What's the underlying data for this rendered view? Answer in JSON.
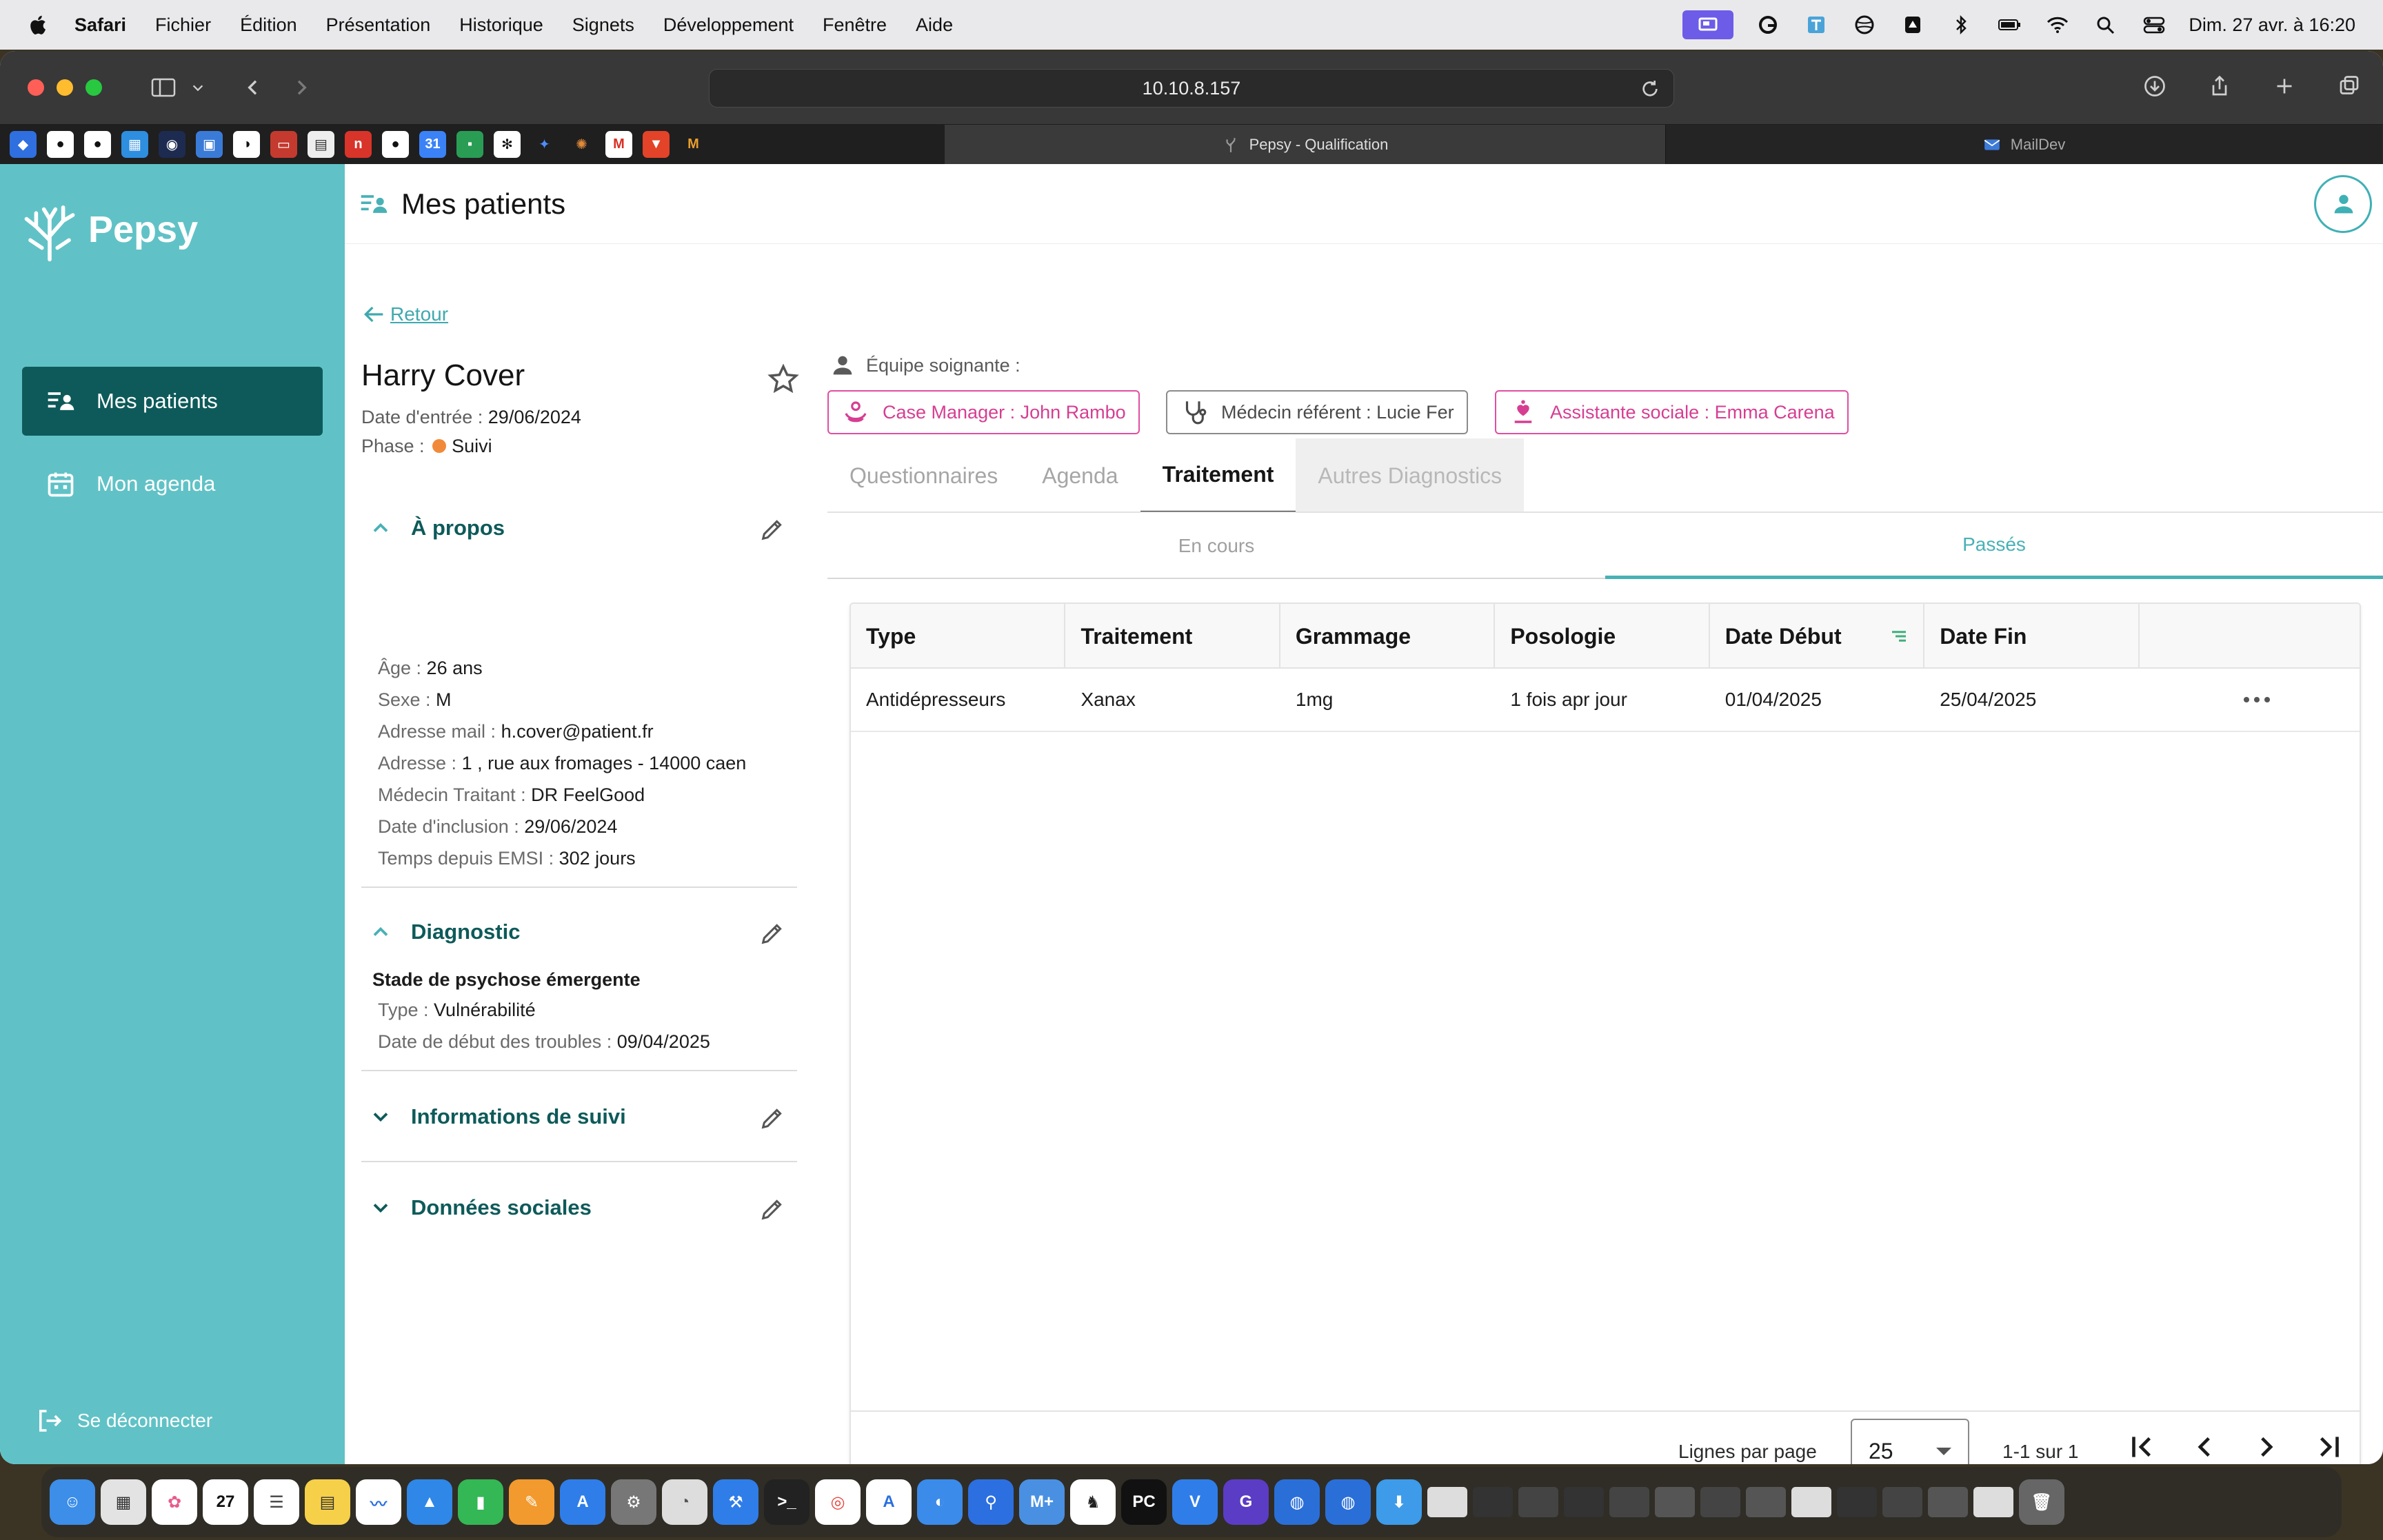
{
  "menubar": {
    "app": "Safari",
    "items": [
      "Fichier",
      "Édition",
      "Présentation",
      "Historique",
      "Signets",
      "Développement",
      "Fenêtre",
      "Aide"
    ],
    "clock": "Dim. 27 avr. à 16:20"
  },
  "browser": {
    "url": "10.10.8.157",
    "tabs": [
      {
        "label": "Pepsy - Qualification",
        "active": true
      },
      {
        "label": "MailDev",
        "active": false
      }
    ]
  },
  "sidebar": {
    "brand": "Pepsy",
    "nav": [
      {
        "label": "Mes patients",
        "active": true
      },
      {
        "label": "Mon agenda",
        "active": false
      }
    ],
    "logout": "Se déconnecter"
  },
  "header": {
    "title": "Mes patients"
  },
  "patient": {
    "back_label": "Retour",
    "name": "Harry Cover",
    "entry_label": "Date d'entrée : ",
    "entry_date": "29/06/2024",
    "phase_label": "Phase : ",
    "phase": "Suivi",
    "phase_color": "#f08a3a"
  },
  "about": {
    "title": "À propos",
    "fields": [
      {
        "label": "Âge : ",
        "value": "26 ans"
      },
      {
        "label": "Sexe : ",
        "value": "M"
      },
      {
        "label": "Adresse mail : ",
        "value": "h.cover@patient.fr"
      },
      {
        "label": "Adresse : ",
        "value": "1 , rue aux fromages - 14000 caen"
      },
      {
        "label": "Médecin Traitant : ",
        "value": "DR FeelGood"
      },
      {
        "label": "Date d'inclusion : ",
        "value": "29/06/2024"
      },
      {
        "label": "Temps depuis EMSI : ",
        "value": "302 jours"
      }
    ]
  },
  "diagnostic": {
    "title": "Diagnostic",
    "stage": "Stade de psychose émergente",
    "fields": [
      {
        "label": "Type : ",
        "value": "Vulnérabilité"
      },
      {
        "label": "Date de début des troubles : ",
        "value": "09/04/2025"
      }
    ]
  },
  "followup": {
    "title": "Informations de suivi"
  },
  "social": {
    "title": "Données sociales"
  },
  "team": {
    "label": "Équipe soignante :",
    "members": [
      {
        "label": "Case Manager : John Rambo",
        "style": "pink"
      },
      {
        "label": "Médecin référent : Lucie Fer",
        "style": "grey"
      },
      {
        "label": "Assistante sociale : Emma Carena",
        "style": "pink"
      }
    ]
  },
  "tabs": [
    "Questionnaires",
    "Agenda",
    "Traitement",
    "Autres Diagnostics"
  ],
  "active_tab": "Traitement",
  "subtabs": [
    "En cours",
    "Passés"
  ],
  "active_subtab": "Passés",
  "table": {
    "columns": [
      "Type",
      "Traitement",
      "Grammage",
      "Posologie",
      "Date Début",
      "Date Fin"
    ],
    "rows": [
      [
        "Antidépresseurs",
        "Xanax",
        "1mg",
        "1 fois apr jour",
        "01/04/2025",
        "25/04/2025"
      ]
    ],
    "rows_per_page_label": "Lignes par page",
    "rows_per_page": "25",
    "range": "1-1 sur 1"
  },
  "colors": {
    "sidebar": "#60c2c6",
    "nav_active": "#0e5a5a",
    "accent": "#48b1b6",
    "pink": "#e04fa0"
  }
}
